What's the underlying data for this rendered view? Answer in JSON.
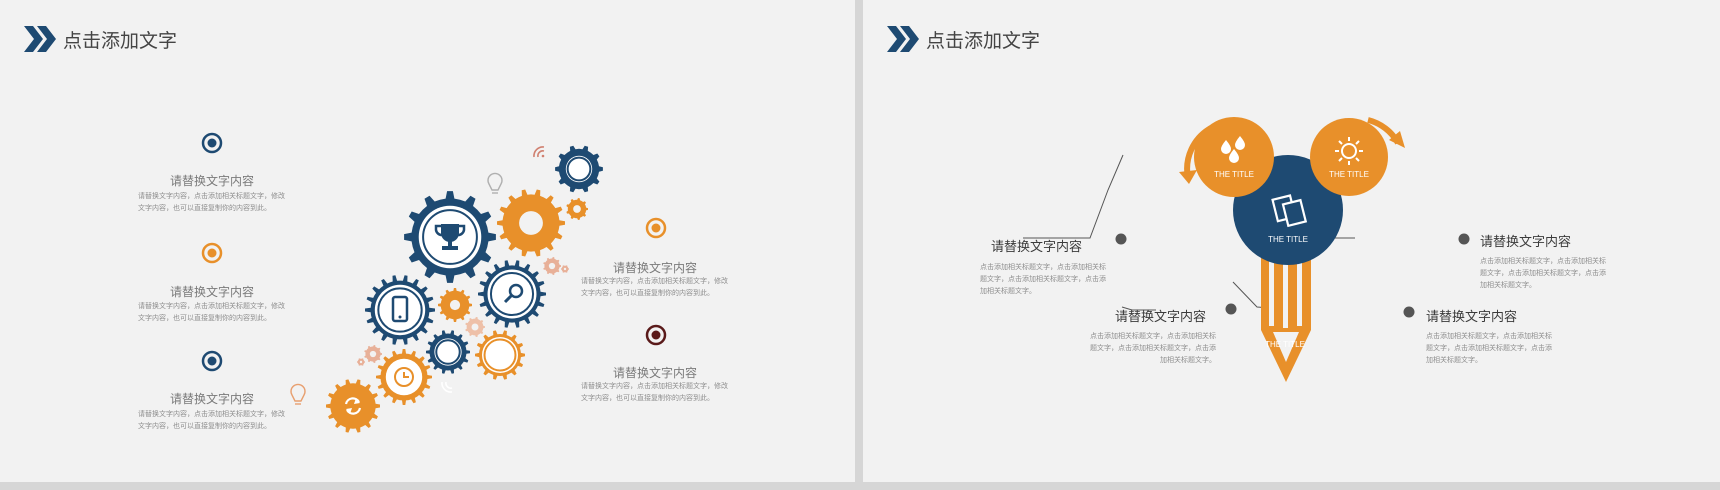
{
  "colors": {
    "navy": "#1e4a72",
    "orange": "#e8902a",
    "dark_red": "#5a1a1a",
    "gray_dot": "#555555"
  },
  "left_slide": {
    "title": "点击添加文字",
    "items": [
      {
        "heading": "请替换文字内容",
        "body": "请替换文字内容，点击添加相关标题文字，修改文字内容，也可以直接复制你的内容到此。",
        "icon": "navy-ring-icon"
      },
      {
        "heading": "请替换文字内容",
        "body": "请替换文字内容，点击添加相关标题文字，修改文字内容，也可以直接复制你的内容到此。",
        "icon": "orange-ring-icon"
      },
      {
        "heading": "请替换文字内容",
        "body": "请替换文字内容，点击添加相关标题文字，修改文字内容，也可以直接复制你的内容到此。",
        "icon": "navy-ring-icon"
      },
      {
        "heading": "请替换文字内容",
        "body": "请替换文字内容，点击添加相关标题文字，修改文字内容，也可以直接复制你的内容到此。",
        "icon": "orange-ring-icon"
      },
      {
        "heading": "请替换文字内容",
        "body": "请替换文字内容，点击添加相关标题文字，修改文字内容，也可以直接复制你的内容到此。",
        "icon": "dark-red-ring-icon"
      }
    ],
    "gear_icons": [
      "trophy-icon",
      "smartphone-icon",
      "magnifier-icon",
      "clock-icon",
      "refresh-icon",
      "lightbulb-icon",
      "wifi-icon"
    ]
  },
  "right_slide": {
    "title": "点击添加文字",
    "circles": [
      {
        "label": "THE TITLE",
        "icon": "water-drops-icon"
      },
      {
        "label": "THE TITLE",
        "icon": "documents-icon"
      },
      {
        "label": "THE TITLE",
        "icon": "sun-icon"
      },
      {
        "label": "THE TITLE",
        "icon": "pencil-icon"
      }
    ],
    "callouts": [
      {
        "heading": "请替换文字内容",
        "body": "点击添加相关标题文字，点击添加相关标题文字，点击添加相关标题文字，点击添加相关标题文字。"
      },
      {
        "heading": "请替换文字内容",
        "body": "点击添加相关标题文字，点击添加相关标题文字，点击添加相关标题文字，点击添加相关标题文字。"
      },
      {
        "heading": "请替换文字内容",
        "body": "点击添加相关标题文字，点击添加相关标题文字，点击添加相关标题文字，点击添加相关标题文字。"
      },
      {
        "heading": "请替换文字内容",
        "body": "点击添加相关标题文字，点击添加相关标题文字，点击添加相关标题文字，点击添加相关标题文字。"
      }
    ]
  }
}
